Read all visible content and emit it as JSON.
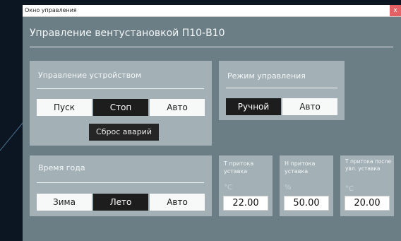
{
  "window": {
    "title": "Окно управления",
    "close_glyph": "x",
    "heading": "Управление вентустановкой П10-В10"
  },
  "device_control": {
    "title": "Управление устройством",
    "buttons": [
      "Пуск",
      "Стоп",
      "Авто"
    ],
    "selected": "Стоп",
    "reset_label": "Сброс аварий"
  },
  "mode_control": {
    "title": "Режим управления",
    "buttons": [
      "Ручной",
      "Авто"
    ],
    "selected": "Ручной"
  },
  "season": {
    "title": "Время года",
    "buttons": [
      "Зима",
      "Лето",
      "Авто"
    ],
    "selected": "Лето"
  },
  "setpoints": [
    {
      "label": "Т притока уставка",
      "unit": "°С",
      "value": "22.00"
    },
    {
      "label": "Н притока уставка",
      "unit": "%",
      "value": "50.00"
    },
    {
      "label": "Т притока после увл. уставка",
      "unit": "°С",
      "value": "20.00"
    }
  ],
  "colors": {
    "background": "#0c1522",
    "window": "#6b7d85",
    "panel": "#a3b1b6",
    "selected_button": "#1d1d1d",
    "close_button": "#e36165"
  }
}
